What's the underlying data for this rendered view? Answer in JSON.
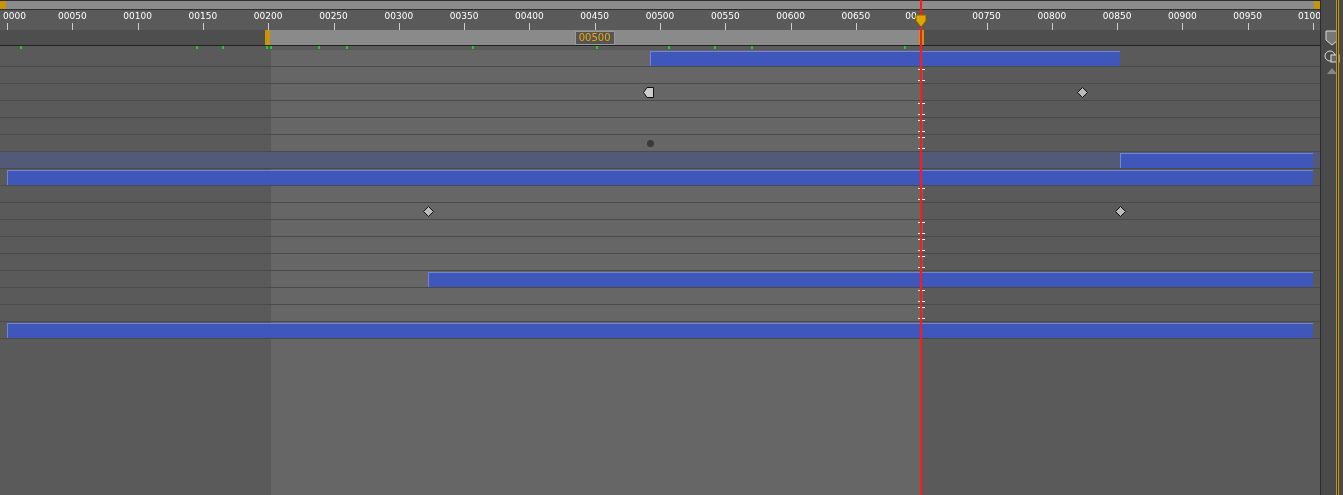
{
  "ruler": {
    "labels": [
      "0000",
      "00050",
      "00100",
      "00150",
      "00200",
      "00250",
      "00300",
      "00350",
      "00400",
      "00450",
      "00500",
      "00550",
      "00600",
      "00650",
      "00",
      "00750",
      "00800",
      "00850",
      "00900",
      "00950",
      "0100"
    ]
  },
  "work_area": {
    "duration": "00500"
  },
  "tracks": [
    {
      "selected": false,
      "items": [
        {
          "kind": "bar"
        }
      ]
    },
    {
      "selected": false,
      "items": [
        {
          "kind": "cursor"
        }
      ]
    },
    {
      "selected": false,
      "items": [
        {
          "kind": "half-key"
        },
        {
          "kind": "key"
        }
      ]
    },
    {
      "selected": false,
      "items": [
        {
          "kind": "cursor"
        }
      ]
    },
    {
      "selected": false,
      "items": [
        {
          "kind": "cursor"
        }
      ]
    },
    {
      "selected": false,
      "items": [
        {
          "kind": "dot"
        },
        {
          "kind": "cursor"
        }
      ]
    },
    {
      "selected": true,
      "items": [
        {
          "kind": "bar"
        }
      ]
    },
    {
      "selected": false,
      "items": [
        {
          "kind": "bar"
        }
      ]
    },
    {
      "selected": false,
      "items": [
        {
          "kind": "cursor"
        }
      ]
    },
    {
      "selected": false,
      "items": [
        {
          "kind": "key"
        },
        {
          "kind": "key"
        }
      ]
    },
    {
      "selected": false,
      "items": [
        {
          "kind": "cursor"
        }
      ]
    },
    {
      "selected": false,
      "items": [
        {
          "kind": "cursor"
        }
      ]
    },
    {
      "selected": false,
      "items": [
        {
          "kind": "cursor"
        }
      ]
    },
    {
      "selected": false,
      "items": [
        {
          "kind": "bar"
        }
      ]
    },
    {
      "selected": false,
      "items": [
        {
          "kind": "cursor"
        }
      ]
    },
    {
      "selected": false,
      "items": [
        {
          "kind": "cursor"
        }
      ]
    },
    {
      "selected": false,
      "items": [
        {
          "kind": "bar"
        }
      ]
    }
  ]
}
